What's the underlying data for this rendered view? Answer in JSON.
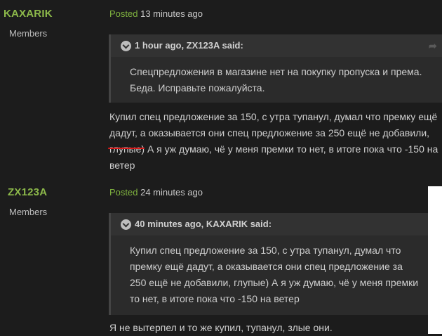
{
  "posts": [
    {
      "author": "KAXARIK",
      "group": "Members",
      "posted_label": "Posted",
      "posted_time": "13 minutes ago",
      "quote": {
        "header": "1 hour ago, ZX123A said:",
        "text": "Спецпредложения в магазине нет на покупку пропуска и према. Беда. Исправьте пожалуйста."
      },
      "body": "Купил спец предложение за 150, с утра тупанул, думал что премку ещё дадут, а оказывается они спец предложение за 250 ещё не добавили, глупые) А я уж думаю, чё у меня премки то нет, в итоге пока что -150 на ветер"
    },
    {
      "author": "ZX123A",
      "group": "Members",
      "posted_label": "Posted",
      "posted_time": "24 minutes ago",
      "quote": {
        "header": "40 minutes ago, KAXARIK said:",
        "text": "Купил спец предложение за 150, с утра тупанул, думал что премку ещё дадут, а оказывается они спец предложение за 250 ещё не добавили, глупые) А я уж думаю, чё у меня премки то нет, в итоге пока что -150 на ветер"
      },
      "body": "Я не вытерпел и то же купил, тупанул, злые они."
    }
  ],
  "icons": {
    "expand": "chevron-down-icon",
    "share": "share-icon"
  },
  "colors": {
    "background": "#1c1c1c",
    "author": "#8cb84a",
    "posted": "#7fb23f",
    "quote_bg": "#2b2b2b",
    "underline": "#d91c1c"
  }
}
